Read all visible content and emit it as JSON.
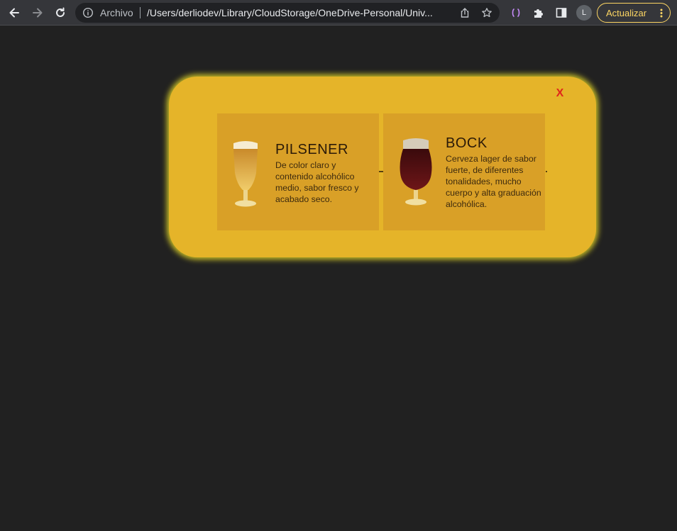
{
  "browser": {
    "omnibox": {
      "security_label": "Archivo",
      "url": "/Users/derliodev/Library/CloudStorage/OneDrive-Personal/Univ..."
    },
    "avatar_initial": "L",
    "update_label": "Actualizar"
  },
  "modal": {
    "close_label": "X",
    "cards": [
      {
        "title": "PILSENER",
        "description": "De color claro y contenido alcohólico medio, sabor fresco y acabado seco.",
        "glass_icon": "pilsner-glass-icon",
        "beer_color": "#e0a93a"
      },
      {
        "title": "BOCK",
        "description": "Cerveza lager de sabor fuerte, de diferentes tonalidades, mucho cuerpo y alta graduación alcohólica.",
        "glass_icon": "bock-glass-icon",
        "beer_color": "#4a0d10"
      }
    ]
  },
  "colors": {
    "page_background": "#212121",
    "modal_background": "#e5b429",
    "modal_glow": "#e6dc28",
    "card_background": "#d9a027",
    "close_color": "#e0251b",
    "update_accent": "#fdd663"
  }
}
